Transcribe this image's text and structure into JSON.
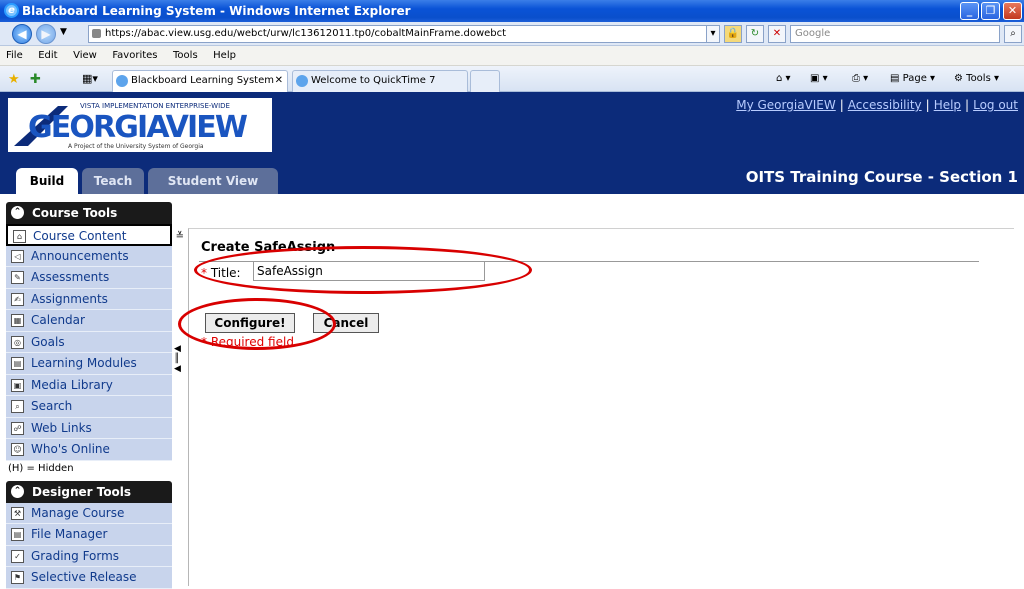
{
  "window": {
    "title": "Blackboard Learning System - Windows Internet Explorer"
  },
  "address_bar": {
    "url": "https://abac.view.usg.edu/webct/urw/lc13612011.tp0/cobaltMainFrame.dowebct",
    "search_placeholder": "Google"
  },
  "menu": [
    "File",
    "Edit",
    "View",
    "Favorites",
    "Tools",
    "Help"
  ],
  "tabs": [
    {
      "label": "Blackboard Learning System",
      "active": true
    },
    {
      "label": "Welcome to QuickTime 7",
      "active": false
    }
  ],
  "command_bar": {
    "page_label": "Page",
    "tools_label": "Tools"
  },
  "header": {
    "logo_top": "VISTA IMPLEMENTATION ENTERPRISE-WIDE",
    "logo_main": "GEORGIAVIEW",
    "logo_sub": "A Project of the University System of Georgia",
    "links": [
      "My GeorgiaVIEW",
      "Accessibility",
      "Help",
      "Log out"
    ],
    "course_title": "OITS Training Course - Section 1",
    "view_tabs": [
      "Build",
      "Teach",
      "Student View"
    ]
  },
  "sidebar": {
    "course_tools_title": "Course Tools",
    "course_tools": [
      {
        "label": "Course Content",
        "icon": "home-icon",
        "selected": true
      },
      {
        "label": "Announcements",
        "icon": "megaphone-icon"
      },
      {
        "label": "Assessments",
        "icon": "assessment-icon"
      },
      {
        "label": "Assignments",
        "icon": "assignment-icon"
      },
      {
        "label": "Calendar",
        "icon": "calendar-icon"
      },
      {
        "label": "Goals",
        "icon": "goals-icon"
      },
      {
        "label": "Learning Modules",
        "icon": "module-icon"
      },
      {
        "label": "Media Library",
        "icon": "media-icon"
      },
      {
        "label": "Search",
        "icon": "search-icon"
      },
      {
        "label": "Web Links",
        "icon": "web-links-icon"
      },
      {
        "label": "Who's Online",
        "icon": "people-icon"
      }
    ],
    "hidden_note": "(H) = Hidden",
    "designer_tools_title": "Designer Tools",
    "designer_tools": [
      {
        "label": "Manage Course",
        "icon": "manage-course-icon"
      },
      {
        "label": "File Manager",
        "icon": "file-manager-icon"
      },
      {
        "label": "Grading Forms",
        "icon": "grading-forms-icon"
      },
      {
        "label": "Selective Release",
        "icon": "selective-release-icon"
      }
    ]
  },
  "main": {
    "heading": "Create SafeAssign",
    "title_label": "Title:",
    "title_value": "SafeAssign",
    "configure_label": "Configure!",
    "cancel_label": "Cancel",
    "required_text": "* Required field"
  }
}
